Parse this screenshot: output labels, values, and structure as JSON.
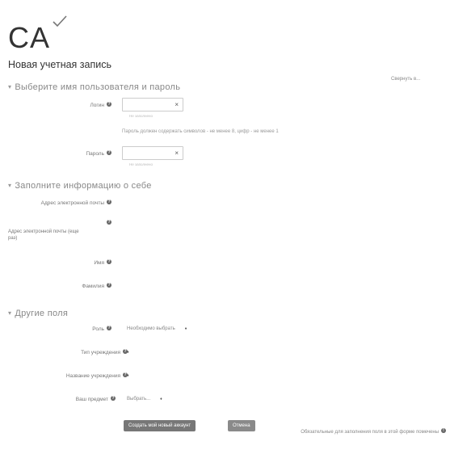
{
  "logo": {
    "text": "CA"
  },
  "page_title": "Новая учетная запись",
  "collapse_all": "Свернуть в...",
  "sections": {
    "username_password": "Выберите имя пользователя и пароль",
    "about_you": "Заполните информацию о себе",
    "other": "Другие поля"
  },
  "fields": {
    "login_label": "Логин",
    "login_hint": "Не заполнено",
    "password_rule": "Пароль должен содержать символов - не менее 8, цифр - не менее 1",
    "password_label": "Пароль",
    "password_hint": "Не заполнено",
    "email_label": "Адрес электронной почты",
    "email2_label": "Адрес электронной почты (еще раз)",
    "firstname_label": "Имя",
    "lastname_label": "Фамилия",
    "role_label": "Роль",
    "role_value": "Необходимо выбрать",
    "org_type_label": "Тип учреждения",
    "org_type_value": "",
    "org_name_label": "Название учреждения",
    "org_name_value": "",
    "region_label": "Ваш предмет",
    "region_value": "Выбрать..."
  },
  "buttons": {
    "create": "Создать мой новый аккаунт",
    "cancel": "Отмена"
  },
  "footer_note": "Обязательные для заполнения поля в этой форме помечены"
}
